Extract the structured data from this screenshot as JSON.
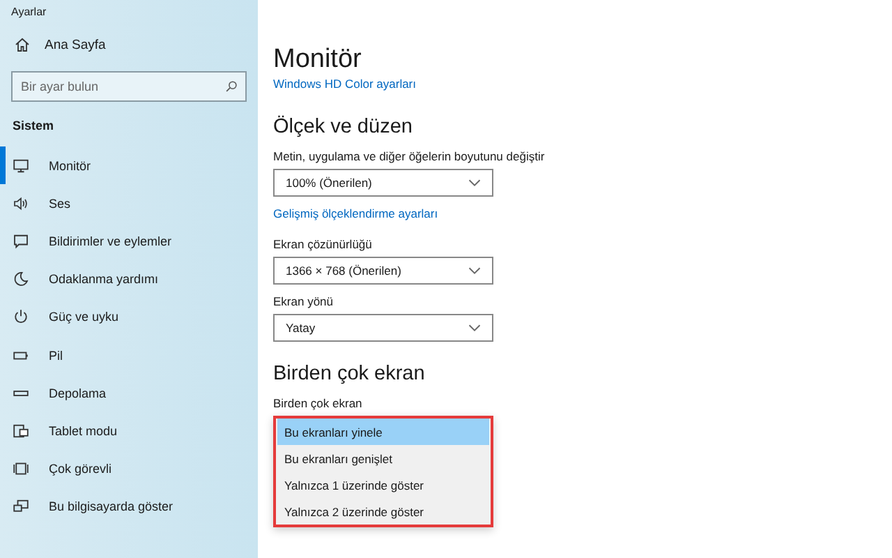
{
  "window": {
    "title": "Ayarlar"
  },
  "sidebar": {
    "home": {
      "label": "Ana Sayfa"
    },
    "search": {
      "placeholder": "Bir ayar bulun"
    },
    "section": "Sistem",
    "items": [
      {
        "label": "Monitör",
        "kind": "monitor",
        "selected": true
      },
      {
        "label": "Ses",
        "kind": "speaker",
        "selected": false
      },
      {
        "label": "Bildirimler ve eylemler",
        "kind": "message",
        "selected": false
      },
      {
        "label": "Odaklanma yardımı",
        "kind": "moon",
        "selected": false
      },
      {
        "label": "Güç ve uyku",
        "kind": "power",
        "selected": false
      },
      {
        "label": "Pil",
        "kind": "battery",
        "selected": false
      },
      {
        "label": "Depolama",
        "kind": "storage",
        "selected": false
      },
      {
        "label": "Tablet modu",
        "kind": "tablet",
        "selected": false
      },
      {
        "label": "Çok görevli",
        "kind": "multitask",
        "selected": false
      },
      {
        "label": "Bu bilgisayarda göster",
        "kind": "project",
        "selected": false
      }
    ]
  },
  "main": {
    "title": "Monitör",
    "hd_link": "Windows HD Color ayarları",
    "scale_section": {
      "heading": "Ölçek ve düzen",
      "fields": [
        {
          "kind": "dropdown",
          "label": "Metin, uygulama ve diğer öğelerin boyutunu değiştir",
          "value": "100% (Önerilen)"
        },
        {
          "kind": "link",
          "label": "Gelişmiş ölçeklendirme ayarları"
        },
        {
          "kind": "dropdown",
          "label": "Ekran çözünürlüğü",
          "value": "1366 × 768 (Önerilen)"
        },
        {
          "kind": "dropdown",
          "label": "Ekran yönü",
          "value": "Yatay"
        }
      ]
    },
    "multi_section": {
      "heading": "Birden çok ekran",
      "label": "Birden çok ekran",
      "options": [
        {
          "label": "Bu ekranları yinele",
          "selected": true
        },
        {
          "label": "Bu ekranları genişlet",
          "selected": false
        },
        {
          "label": "Yalnızca 1 üzerinde göster",
          "selected": false
        },
        {
          "label": "Yalnızca 2 üzerinde göster",
          "selected": false
        }
      ]
    }
  }
}
